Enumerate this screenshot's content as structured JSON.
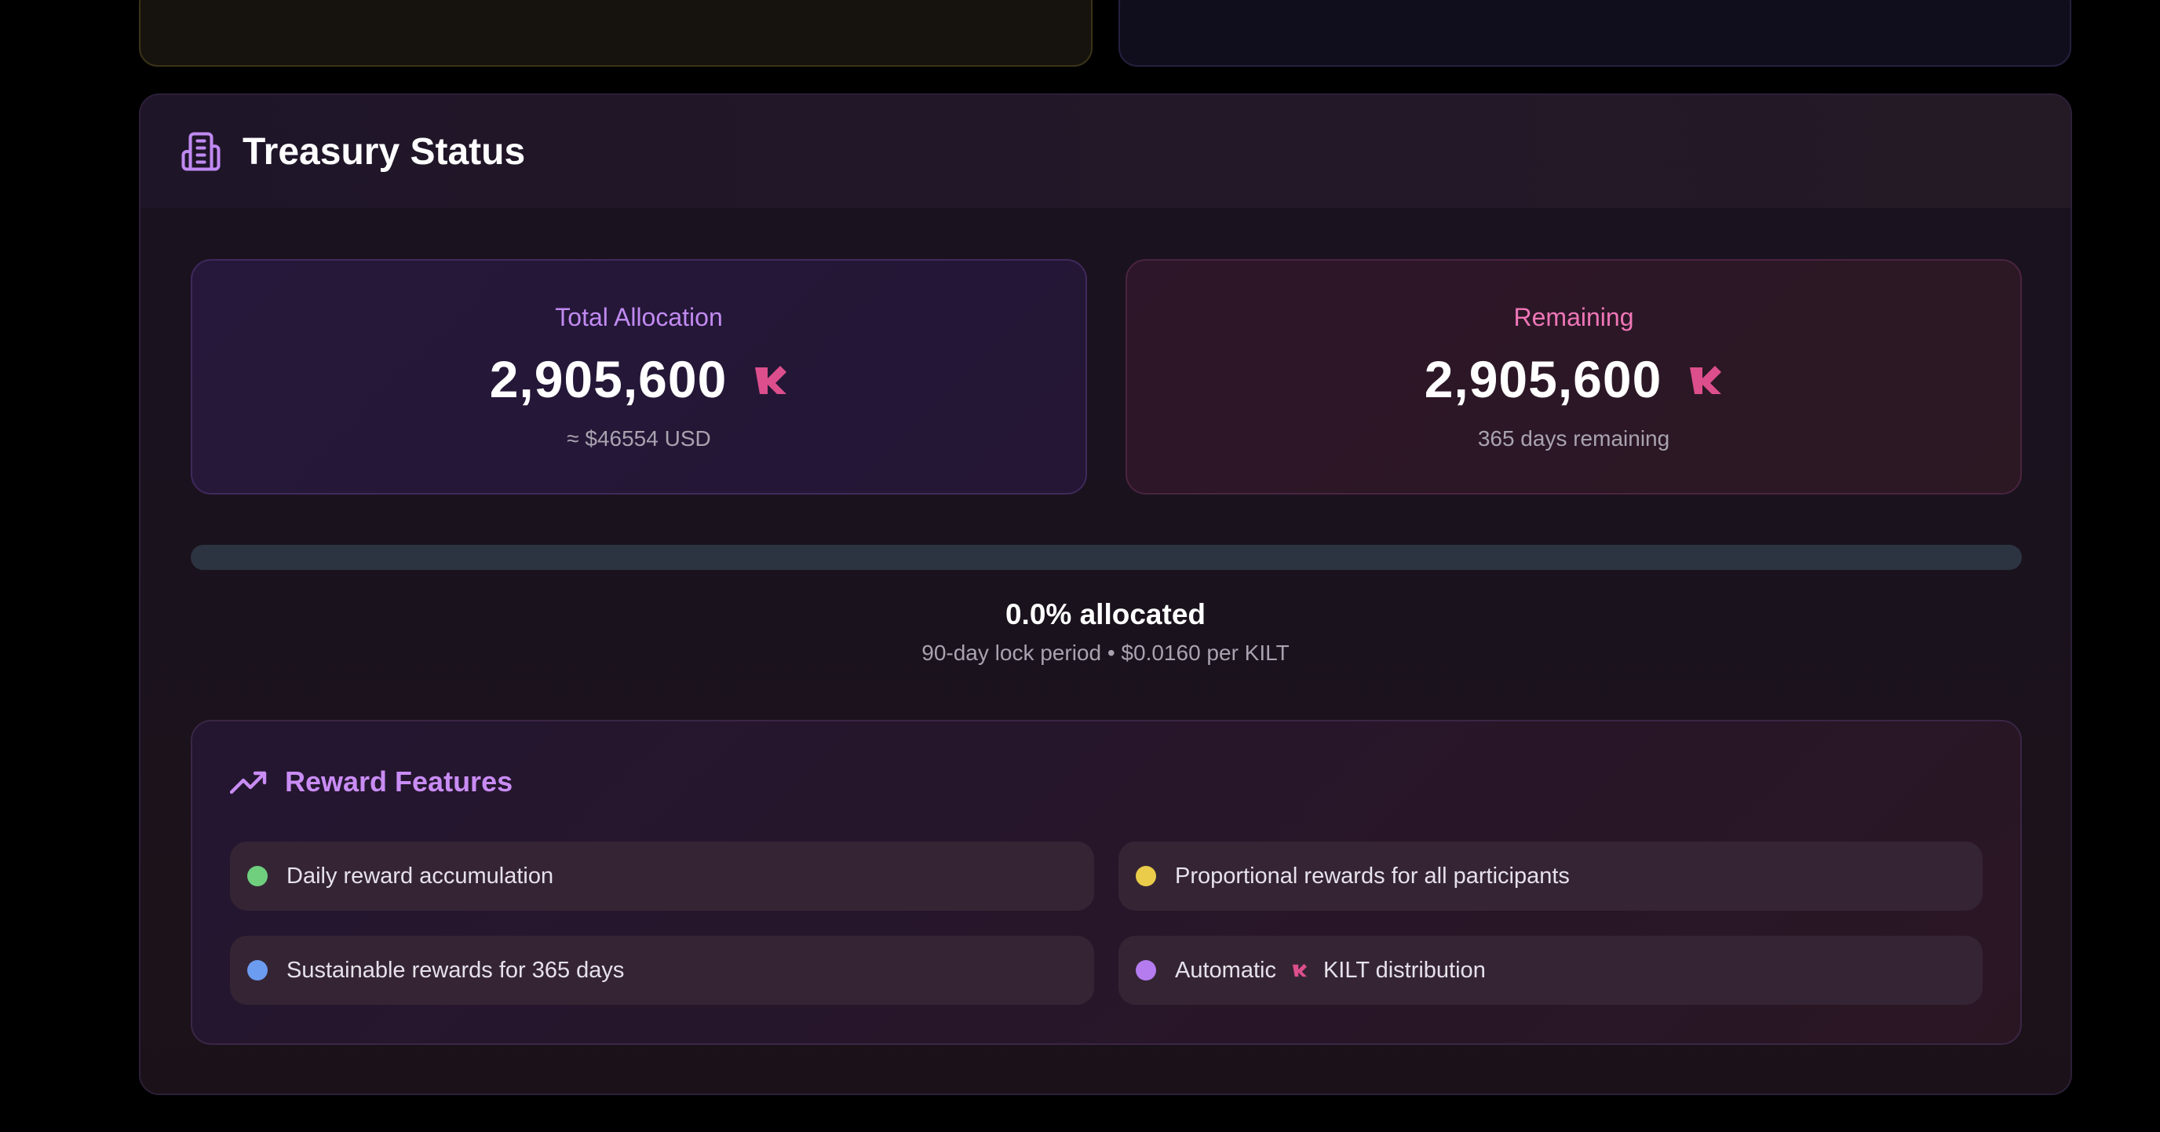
{
  "treasury": {
    "title": "Treasury Status",
    "icon": "building-icon",
    "total": {
      "label": "Total Allocation",
      "value": "2,905,600",
      "sub": "≈ $46554 USD",
      "token_icon": "kilt-logo-icon"
    },
    "remaining": {
      "label": "Remaining",
      "value": "2,905,600",
      "sub": "365 days remaining",
      "token_icon": "kilt-logo-icon"
    },
    "progress": {
      "fraction": 0.0,
      "label": "0.0% allocated",
      "details": "90-day lock period • $0.0160 per KILT"
    }
  },
  "features": {
    "title": "Reward Features",
    "icon": "trending-up-icon",
    "items": [
      {
        "text": "Daily reward accumulation",
        "color": "#6fcf7f"
      },
      {
        "text": "Proportional rewards for all participants",
        "color": "#eacb4a"
      },
      {
        "text": "Sustainable rewards for 365 days",
        "color": "#6c9cf0"
      },
      {
        "pre": "Automatic",
        "post": "KILT distribution",
        "color": "#b57cf0"
      }
    ]
  },
  "colors": {
    "accent_purple": "#c18af2",
    "accent_pink": "#ee76b7",
    "kilt_logo": "#dc4f8c"
  }
}
